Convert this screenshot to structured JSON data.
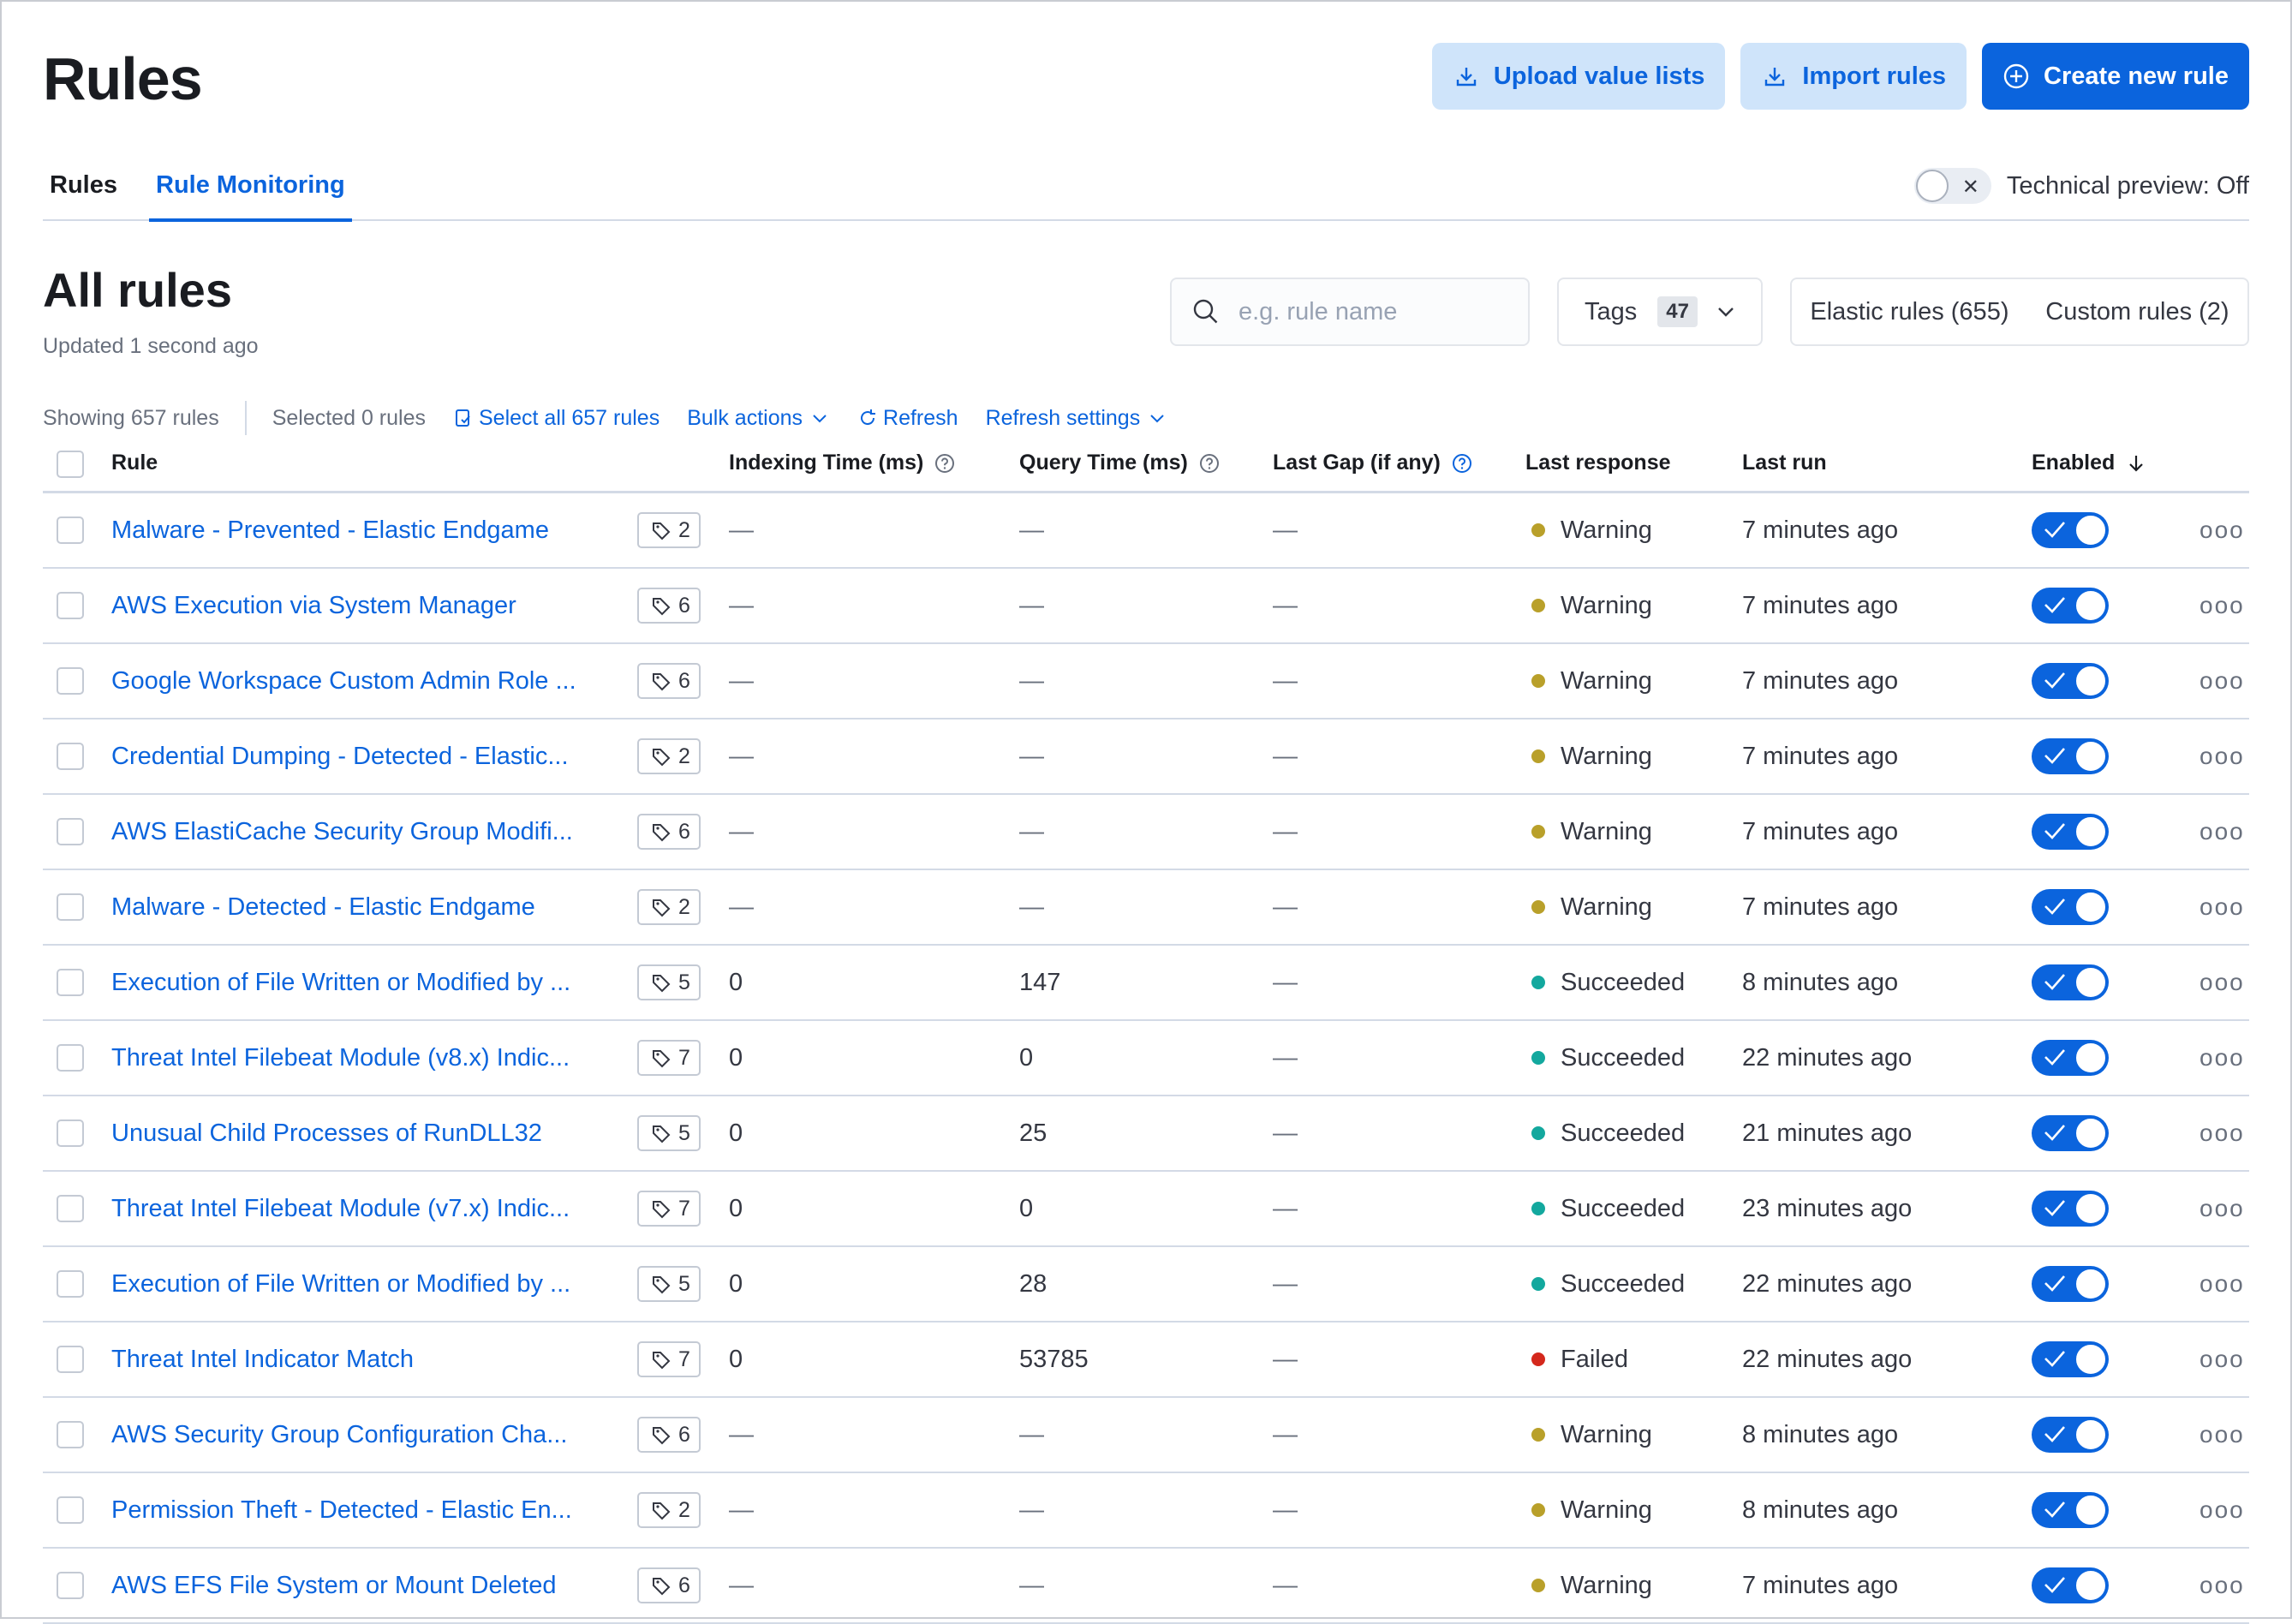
{
  "header": {
    "title": "Rules",
    "upload_label": "Upload value lists",
    "import_label": "Import rules",
    "create_label": "Create new rule"
  },
  "tabs": [
    {
      "label": "Rules"
    },
    {
      "label": "Rule Monitoring",
      "active": true
    }
  ],
  "tech_preview": {
    "label": "Technical preview: Off",
    "enabled": false
  },
  "section": {
    "title": "All rules",
    "updated": "Updated 1 second ago"
  },
  "search": {
    "placeholder": "e.g. rule name",
    "value": ""
  },
  "tags_filter": {
    "label": "Tags",
    "count": "47"
  },
  "rule_filters": {
    "elastic": "Elastic rules (655)",
    "custom": "Custom rules (2)"
  },
  "utility": {
    "showing": "Showing 657 rules",
    "selected": "Selected 0 rules",
    "select_all": "Select all 657 rules",
    "bulk_actions": "Bulk actions",
    "refresh": "Refresh",
    "refresh_settings": "Refresh settings"
  },
  "columns": {
    "rule": "Rule",
    "indexing": "Indexing Time (ms)",
    "query": "Query Time (ms)",
    "gap": "Last Gap (if any)",
    "response": "Last response",
    "last_run": "Last run",
    "enabled": "Enabled"
  },
  "status_colors": {
    "Warning": "#b9a02a",
    "Succeeded": "#13a89e",
    "Failed": "#d4281c"
  },
  "rows": [
    {
      "name": "Malware - Prevented - Elastic Endgame",
      "tags": "2",
      "indexing": "—",
      "query": "—",
      "gap": "—",
      "response": "Warning",
      "last_run": "7 minutes ago",
      "enabled": true
    },
    {
      "name": "AWS Execution via System Manager",
      "tags": "6",
      "indexing": "—",
      "query": "—",
      "gap": "—",
      "response": "Warning",
      "last_run": "7 minutes ago",
      "enabled": true
    },
    {
      "name": "Google Workspace Custom Admin Role ...",
      "tags": "6",
      "indexing": "—",
      "query": "—",
      "gap": "—",
      "response": "Warning",
      "last_run": "7 minutes ago",
      "enabled": true
    },
    {
      "name": "Credential Dumping - Detected - Elastic...",
      "tags": "2",
      "indexing": "—",
      "query": "—",
      "gap": "—",
      "response": "Warning",
      "last_run": "7 minutes ago",
      "enabled": true
    },
    {
      "name": "AWS ElastiCache Security Group Modifi...",
      "tags": "6",
      "indexing": "—",
      "query": "—",
      "gap": "—",
      "response": "Warning",
      "last_run": "7 minutes ago",
      "enabled": true
    },
    {
      "name": "Malware - Detected - Elastic Endgame",
      "tags": "2",
      "indexing": "—",
      "query": "—",
      "gap": "—",
      "response": "Warning",
      "last_run": "7 minutes ago",
      "enabled": true
    },
    {
      "name": "Execution of File Written or Modified by ...",
      "tags": "5",
      "indexing": "0",
      "query": "147",
      "gap": "—",
      "response": "Succeeded",
      "last_run": "8 minutes ago",
      "enabled": true
    },
    {
      "name": "Threat Intel Filebeat Module (v8.x) Indic...",
      "tags": "7",
      "indexing": "0",
      "query": "0",
      "gap": "—",
      "response": "Succeeded",
      "last_run": "22 minutes ago",
      "enabled": true
    },
    {
      "name": "Unusual Child Processes of RunDLL32",
      "tags": "5",
      "indexing": "0",
      "query": "25",
      "gap": "—",
      "response": "Succeeded",
      "last_run": "21 minutes ago",
      "enabled": true
    },
    {
      "name": "Threat Intel Filebeat Module (v7.x) Indic...",
      "tags": "7",
      "indexing": "0",
      "query": "0",
      "gap": "—",
      "response": "Succeeded",
      "last_run": "23 minutes ago",
      "enabled": true
    },
    {
      "name": "Execution of File Written or Modified by ...",
      "tags": "5",
      "indexing": "0",
      "query": "28",
      "gap": "—",
      "response": "Succeeded",
      "last_run": "22 minutes ago",
      "enabled": true
    },
    {
      "name": "Threat Intel Indicator Match",
      "tags": "7",
      "indexing": "0",
      "query": "53785",
      "gap": "—",
      "response": "Failed",
      "last_run": "22 minutes ago",
      "enabled": true
    },
    {
      "name": "AWS Security Group Configuration Cha...",
      "tags": "6",
      "indexing": "—",
      "query": "—",
      "gap": "—",
      "response": "Warning",
      "last_run": "8 minutes ago",
      "enabled": true
    },
    {
      "name": "Permission Theft - Detected - Elastic En...",
      "tags": "2",
      "indexing": "—",
      "query": "—",
      "gap": "—",
      "response": "Warning",
      "last_run": "8 minutes ago",
      "enabled": true
    },
    {
      "name": "AWS EFS File System or Mount Deleted",
      "tags": "6",
      "indexing": "—",
      "query": "—",
      "gap": "—",
      "response": "Warning",
      "last_run": "7 minutes ago",
      "enabled": true
    }
  ]
}
